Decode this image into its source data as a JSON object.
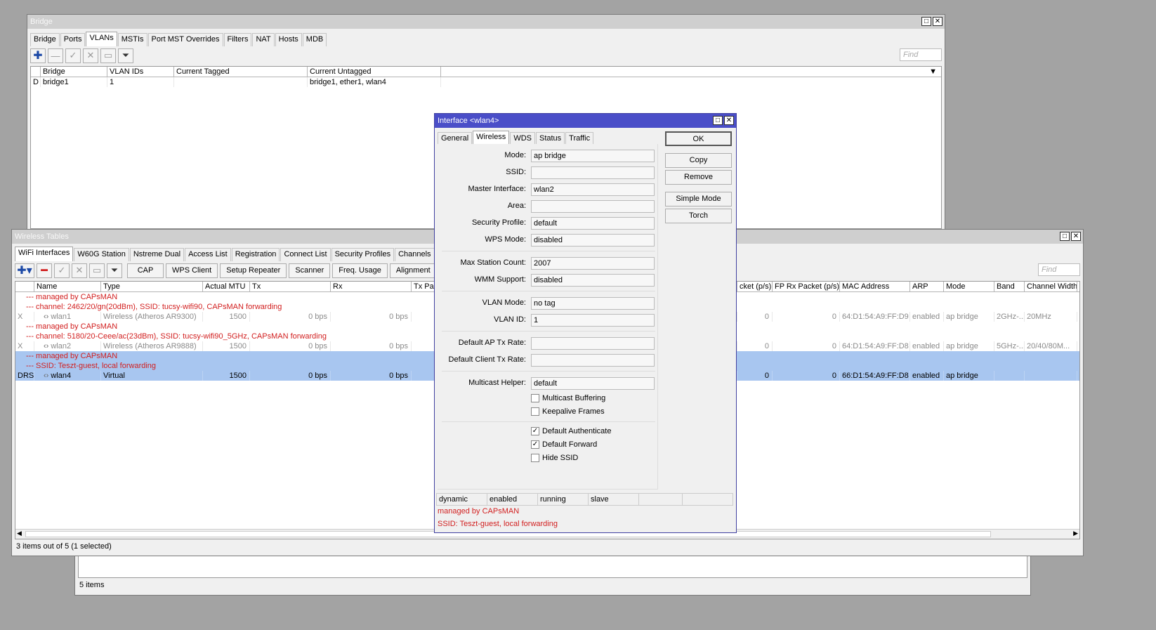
{
  "bridge_window": {
    "title": "Bridge",
    "tabs": [
      "Bridge",
      "Ports",
      "VLANs",
      "MSTIs",
      "Port MST Overrides",
      "Filters",
      "NAT",
      "Hosts",
      "MDB"
    ],
    "active_tab": "VLANs",
    "find_placeholder": "Find",
    "columns": [
      "Bridge",
      "VLAN IDs",
      "Current Tagged",
      "Current Untagged"
    ],
    "rows": [
      {
        "flag": "D",
        "bridge": "bridge1",
        "vlan_ids": "1",
        "tagged": "",
        "untagged": "bridge1, ether1, wlan4"
      }
    ]
  },
  "bottom_window": {
    "status": "5 items"
  },
  "wireless_window": {
    "title": "Wireless Tables",
    "tabs": [
      "WiFi Interfaces",
      "W60G Station",
      "Nstreme Dual",
      "Access List",
      "Registration",
      "Connect List",
      "Security Profiles",
      "Channels"
    ],
    "active_tab": "WiFi Interfaces",
    "toolbar_buttons": [
      "CAP",
      "WPS Client",
      "Setup Repeater",
      "Scanner",
      "Freq. Usage",
      "Alignment"
    ],
    "find_placeholder": "Find",
    "columns_left": [
      "Name",
      "Type",
      "Actual MTU",
      "Tx",
      "Rx",
      "Tx Pac"
    ],
    "columns_right": [
      "cket (p/s)",
      "FP Rx Packet (p/s)",
      "MAC Address",
      "ARP",
      "Mode",
      "Band",
      "Channel Width"
    ],
    "rows": [
      {
        "kind": "note",
        "text": "--- managed by CAPsMAN"
      },
      {
        "kind": "note",
        "text": "--- channel: 2462/20/gn(20dBm), SSID: tucsy-wifi90, CAPsMAN forwarding"
      },
      {
        "kind": "data",
        "style": "dim",
        "flag": "X",
        "name": "wlan1",
        "type": "Wireless (Atheros AR9300)",
        "mtu": "1500",
        "tx": "0 bps",
        "rx": "0 bps",
        "txp": "0",
        "rxp": "0",
        "mac": "64:D1:54:A9:FF:D9",
        "arp": "enabled",
        "mode": "ap bridge",
        "band": "2GHz-...",
        "width": "20MHz"
      },
      {
        "kind": "note",
        "text": "--- managed by CAPsMAN"
      },
      {
        "kind": "note",
        "text": "--- channel: 5180/20-Ceee/ac(23dBm), SSID: tucsy-wifi90_5GHz, CAPsMAN forwarding"
      },
      {
        "kind": "data",
        "style": "dim",
        "flag": "X",
        "name": "wlan2",
        "type": "Wireless (Atheros AR9888)",
        "mtu": "1500",
        "tx": "0 bps",
        "rx": "0 bps",
        "txp": "0",
        "rxp": "0",
        "mac": "64:D1:54:A9:FF:D8",
        "arp": "enabled",
        "mode": "ap bridge",
        "band": "5GHz-...",
        "width": "20/40/80M..."
      },
      {
        "kind": "note",
        "style": "sel",
        "text": "--- managed by CAPsMAN"
      },
      {
        "kind": "note",
        "style": "sel",
        "text": "--- SSID: Teszt-guest, local forwarding"
      },
      {
        "kind": "data",
        "style": "sel",
        "flag": "DRS",
        "name": "wlan4",
        "type": "Virtual",
        "mtu": "1500",
        "tx": "0 bps",
        "rx": "0 bps",
        "txp": "0",
        "rxp": "0",
        "mac": "66:D1:54:A9:FF:D8",
        "arp": "enabled",
        "mode": "ap bridge",
        "band": "",
        "width": ""
      }
    ],
    "status": "3 items out of 5 (1 selected)"
  },
  "dialog": {
    "title": "Interface <wlan4>",
    "tabs": [
      "General",
      "Wireless",
      "WDS",
      "Status",
      "Traffic"
    ],
    "active_tab": "Wireless",
    "fields": {
      "mode": {
        "label": "Mode:",
        "value": "ap bridge"
      },
      "ssid": {
        "label": "SSID:",
        "value": ""
      },
      "master": {
        "label": "Master Interface:",
        "value": "wlan2"
      },
      "area": {
        "label": "Area:",
        "value": ""
      },
      "security": {
        "label": "Security Profile:",
        "value": "default"
      },
      "wps": {
        "label": "WPS Mode:",
        "value": "disabled"
      },
      "maxsta": {
        "label": "Max Station Count:",
        "value": "2007"
      },
      "wmm": {
        "label": "WMM Support:",
        "value": "disabled"
      },
      "vlanmode": {
        "label": "VLAN Mode:",
        "value": "no tag"
      },
      "vlanid": {
        "label": "VLAN ID:",
        "value": "1"
      },
      "aptx": {
        "label": "Default AP Tx Rate:",
        "value": ""
      },
      "clienttx": {
        "label": "Default Client Tx Rate:",
        "value": ""
      },
      "mcast": {
        "label": "Multicast Helper:",
        "value": "default"
      }
    },
    "checkboxes": {
      "mcast_buf": {
        "label": "Multicast Buffering",
        "checked": false
      },
      "keepalive": {
        "label": "Keepalive Frames",
        "checked": false
      },
      "def_auth": {
        "label": "Default Authenticate",
        "checked": true
      },
      "def_fwd": {
        "label": "Default Forward",
        "checked": true
      },
      "hide_ssid": {
        "label": "Hide SSID",
        "checked": false
      }
    },
    "buttons": {
      "ok": "OK",
      "copy": "Copy",
      "remove": "Remove",
      "simple": "Simple Mode",
      "torch": "Torch"
    },
    "status": [
      "dynamic",
      "enabled",
      "running",
      "slave",
      "",
      ""
    ],
    "notes": [
      "managed by CAPsMAN",
      "SSID: Teszt-guest, local forwarding"
    ]
  }
}
